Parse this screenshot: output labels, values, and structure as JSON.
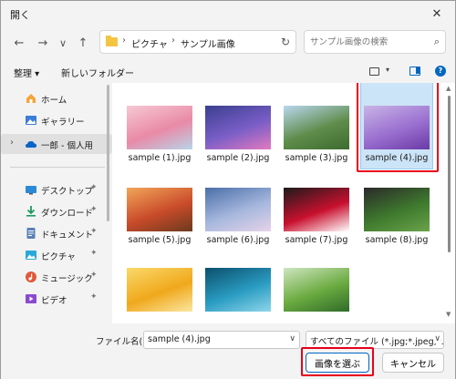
{
  "window": {
    "title": "開く",
    "close_glyph": "✕"
  },
  "nav": {
    "back_glyph": "←",
    "forward_glyph": "→",
    "recent_glyph": "∨",
    "up_glyph": "↑",
    "breadcrumb": [
      "ピクチャ",
      "サンプル画像"
    ],
    "sep_glyph": "›",
    "refresh_glyph": "↻",
    "search_placeholder": "サンプル画像の検索",
    "search_glyph": "⌕"
  },
  "toolbar": {
    "organize": "整理 ▾",
    "new_folder": "新しいフォルダー"
  },
  "sidebar": {
    "items": [
      {
        "label": "ホーム",
        "icon": "home-icon"
      },
      {
        "label": "ギャラリー",
        "icon": "gallery-icon"
      },
      {
        "label": "一郎 - 個人用",
        "icon": "cloud-icon",
        "expander": "›"
      }
    ],
    "quick": [
      {
        "label": "デスクトップ",
        "icon": "desktop-icon"
      },
      {
        "label": "ダウンロード",
        "icon": "download-icon"
      },
      {
        "label": "ドキュメント",
        "icon": "document-icon"
      },
      {
        "label": "ピクチャ",
        "icon": "picture-icon"
      },
      {
        "label": "ミュージック",
        "icon": "music-icon"
      },
      {
        "label": "ビデオ",
        "icon": "video-icon"
      }
    ],
    "pin_glyph": "📌"
  },
  "files": [
    {
      "name": "sample (1).jpg",
      "colors": [
        "#f6c9d4",
        "#e98aa7",
        "#b8d4e8"
      ]
    },
    {
      "name": "sample (2).jpg",
      "colors": [
        "#3a3f8f",
        "#7a5ec7",
        "#e27ac0"
      ]
    },
    {
      "name": "sample (3).jpg",
      "colors": [
        "#b9d7ef",
        "#5e8c4a",
        "#3d6b2f"
      ]
    },
    {
      "name": "sample (4).jpg",
      "colors": [
        "#c8b4e6",
        "#9a6fd0",
        "#6b3aa6"
      ]
    },
    {
      "name": "sample (5).jpg",
      "colors": [
        "#f2a65a",
        "#c94b2a",
        "#6b3a1e"
      ]
    },
    {
      "name": "sample (6).jpg",
      "colors": [
        "#4a6fa8",
        "#a7b8de",
        "#e6d3e8"
      ]
    },
    {
      "name": "sample (7).jpg",
      "colors": [
        "#1b1b1b",
        "#c8102e",
        "#ffffff"
      ]
    },
    {
      "name": "sample (8).jpg",
      "colors": [
        "#2a2a2a",
        "#3f7a2e",
        "#6aa34a"
      ]
    },
    {
      "name": "",
      "colors": [
        "#f9d96a",
        "#f0a81c",
        "#fbe7a0"
      ]
    },
    {
      "name": "",
      "colors": [
        "#0b4f6c",
        "#2a9cc2",
        "#8fd6ea"
      ]
    },
    {
      "name": "",
      "colors": [
        "#cfe5c0",
        "#6aaa3f",
        "#2f6b2a"
      ]
    }
  ],
  "selected_index": 3,
  "bottom": {
    "filename_label": "ファイル名(N):",
    "filename_value": "sample (4).jpg",
    "filetype_value": "すべてのファイル (*.jpg;*.jpeg;*.bmp",
    "dropdown_glyph": "∨",
    "ok_label": "画像を選ぶ",
    "cancel_label": "キャンセル"
  },
  "colors": {
    "accent": "#0067c0",
    "highlight": "#e8001c",
    "selection_bg": "#cce4f7"
  }
}
